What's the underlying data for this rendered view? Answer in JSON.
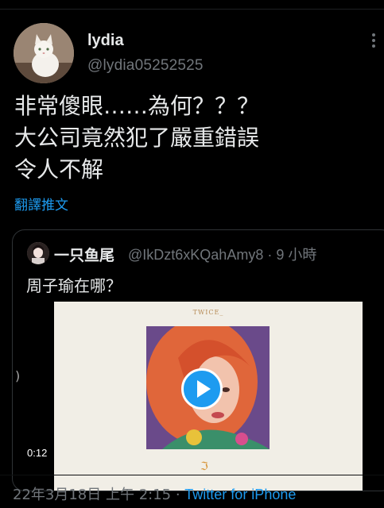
{
  "tweet": {
    "display_name": "lydia",
    "handle": "@lydia05252525",
    "lines": [
      "非常傻眼……為何？？？",
      "大公司竟然犯了嚴重錯誤",
      "令人不解"
    ],
    "translate_label": "翻譯推文"
  },
  "quote": {
    "display_name": "一只鱼尾",
    "handle_time": "@IkDzt6xKQahAmy8 · 9 小時",
    "text": "周子瑜在哪？",
    "media": {
      "header_text": "TWICE_",
      "duration": "0:12"
    }
  },
  "footer": {
    "timestamp": "22年3月18日 上午 2:15 · ",
    "source": "Twitter for iPhone"
  },
  "colors": {
    "background": "#000000",
    "text": "#e7e9ea",
    "secondary": "#71767b",
    "accent": "#1d9bf0"
  }
}
